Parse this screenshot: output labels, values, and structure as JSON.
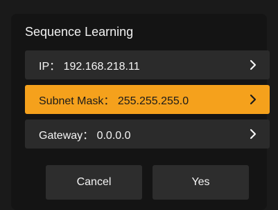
{
  "dialog": {
    "title": "Sequence Learning",
    "rows": [
      {
        "label": "IP：",
        "value": "192.168.218.11",
        "text": "IP： 192.168.218.11",
        "icon": "chevron-right-icon"
      },
      {
        "label": "Subnet Mask：",
        "value": "255.255.255.0",
        "text": "Subnet Mask： 255.255.255.0",
        "icon": "chevron-right-icon",
        "selected": true
      },
      {
        "label": "Gateway：",
        "value": "0.0.0.0",
        "text": "Gateway： 0.0.0.0",
        "icon": "chevron-right-icon"
      }
    ],
    "buttons": {
      "cancel": "Cancel",
      "yes": "Yes"
    }
  },
  "colors": {
    "selected": "#f5a11c",
    "row": "#2b2b2b",
    "button": "#2d2d2d",
    "background": "#141414"
  }
}
